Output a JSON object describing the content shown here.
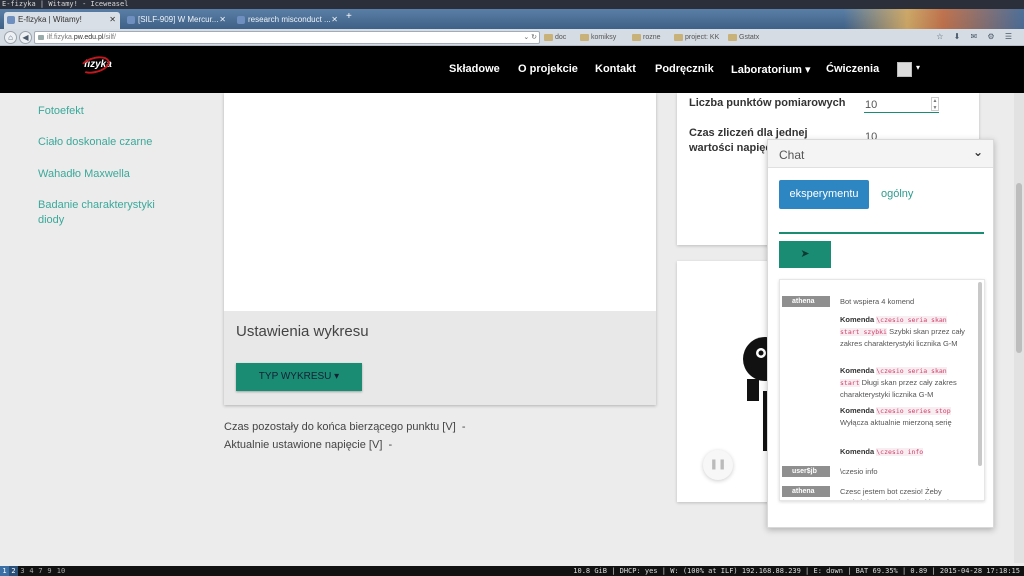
{
  "window_title": "E-fizyka | Witamy! - Iceweasel",
  "browser": {
    "tabs": [
      {
        "label": "E-fizyka | Witamy!"
      },
      {
        "label": "[SILF-909] W Mercur..."
      },
      {
        "label": "research misconduct ..."
      }
    ],
    "new_tab": "+",
    "url_prefix": "ilf.fizyka.",
    "url_host": "pw.edu.pl",
    "url_suffix": "/silf/",
    "bookmarks": [
      "doc",
      "komiksy",
      "rozne",
      "project: KK",
      "Gstatx"
    ]
  },
  "site": {
    "logo": "fizyka",
    "nav": [
      "Składowe",
      "O projekcie",
      "Kontakt",
      "Podręcznik",
      "Laboratorium ▾",
      "Ćwiczenia"
    ],
    "avatar_caret": "▾"
  },
  "sidebar": {
    "items": [
      "Fotoefekt",
      "Ciało doskonale czarne",
      "Wahadło Maxwella",
      "Badanie charakterystyki diody"
    ]
  },
  "chart_panel": {
    "title": "Ustawienia wykresu",
    "type_button": "TYP WYKRESU ▾"
  },
  "status": {
    "time_left_label": "Czas pozostały do końca bierzącego punktu [V]",
    "time_left_value": "-",
    "voltage_label": "Aktualnie ustawione napięcie [V]",
    "voltage_value": "-"
  },
  "settings": {
    "points_label": "Liczba punktów pomiarowych",
    "points_value": "10",
    "count_time_label": "Czas zliczeń dla jednej wartości napięcia [sek]",
    "count_time_value": "10"
  },
  "chat": {
    "title": "Chat",
    "toggle": "⌄",
    "tab_experiment": "eksperymentu",
    "tab_general": "ogólny",
    "send_label": "➤",
    "messages": [
      {
        "user": "athena",
        "text": "Bot wspiera 4 komend"
      },
      {
        "keyword": "Komenda",
        "code": "\\czesio seria skan start szybki",
        "text": "Szybki skan przez cały zakres charakterystyki licznika G-M"
      },
      {
        "keyword": "Komenda",
        "code": "\\czesio seria skan start",
        "text": "Długi skan przez cały zakres charakterystyki licznika G-M"
      },
      {
        "keyword": "Komenda",
        "code": "\\czesio series stop",
        "text": "Wyłącza aktualnie mierzoną serię"
      },
      {
        "keyword": "Komenda",
        "code": "\\czesio info",
        "text": ""
      },
      {
        "user": "user$jb",
        "text": "\\czesio info"
      },
      {
        "user": "athena",
        "text": "Czesc jestem bot czesio! Żeby wysłać do mnie wiadomość musisz"
      }
    ]
  },
  "statusbar": {
    "workspaces": [
      "1",
      "2",
      "3",
      "4",
      "7",
      "9",
      "10"
    ],
    "right_text": "10.8 GiB | DHCP: yes | W: (100% at ILF) 192.168.88.239 | E: down | BAT 69.35% | 0.89 | 2015-04-28 17:18:15"
  },
  "colors": {
    "accent_teal": "#1b8c74",
    "link_teal": "#3aa99a",
    "chat_tab_blue": "#2d86c2",
    "navbar_black": "#000000"
  }
}
